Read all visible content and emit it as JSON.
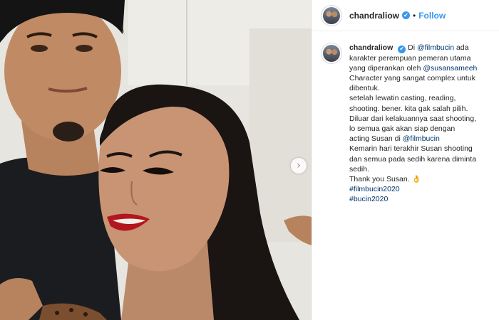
{
  "post": {
    "username": "chandraliow",
    "verified_mark": "✔",
    "separator": "•",
    "follow_label": "Follow",
    "next_arrow": "›",
    "caption": {
      "line1_prefix": "Di",
      "mention_film": "@filmbucin",
      "line1_suffix": "ada",
      "line2": "karakter perempuan pemeran utama",
      "line3_prefix": "yang diperankan oleh",
      "mention_susan": "@susansameeh",
      "line4": "Character yang sangat complex untuk",
      "line5": "dibentuk.",
      "line6": "setelah lewatin casting, reading,",
      "line7": "shooting. bener. kita gak salah pilih.",
      "line8": "Diluar dari kelakuannya saat shooting,",
      "line9": "lo semua gak akan siap dengan",
      "line10_prefix": "acting Susan di",
      "mention_film2": "@filmbucin",
      "line11": "Kemarin hari terakhir Susan shooting",
      "line12": "dan semua pada sedih karena diminta",
      "line13": "sedih.",
      "line14": "Thank you Susan. 👌",
      "hashtag1": "#filmbucin2020",
      "hashtag2": "#bucin2020"
    }
  },
  "colors": {
    "accent": "#3897f0",
    "link": "#003569",
    "text": "#262626"
  },
  "icons": [
    "verified-badge-icon",
    "chevron-right-icon"
  ]
}
